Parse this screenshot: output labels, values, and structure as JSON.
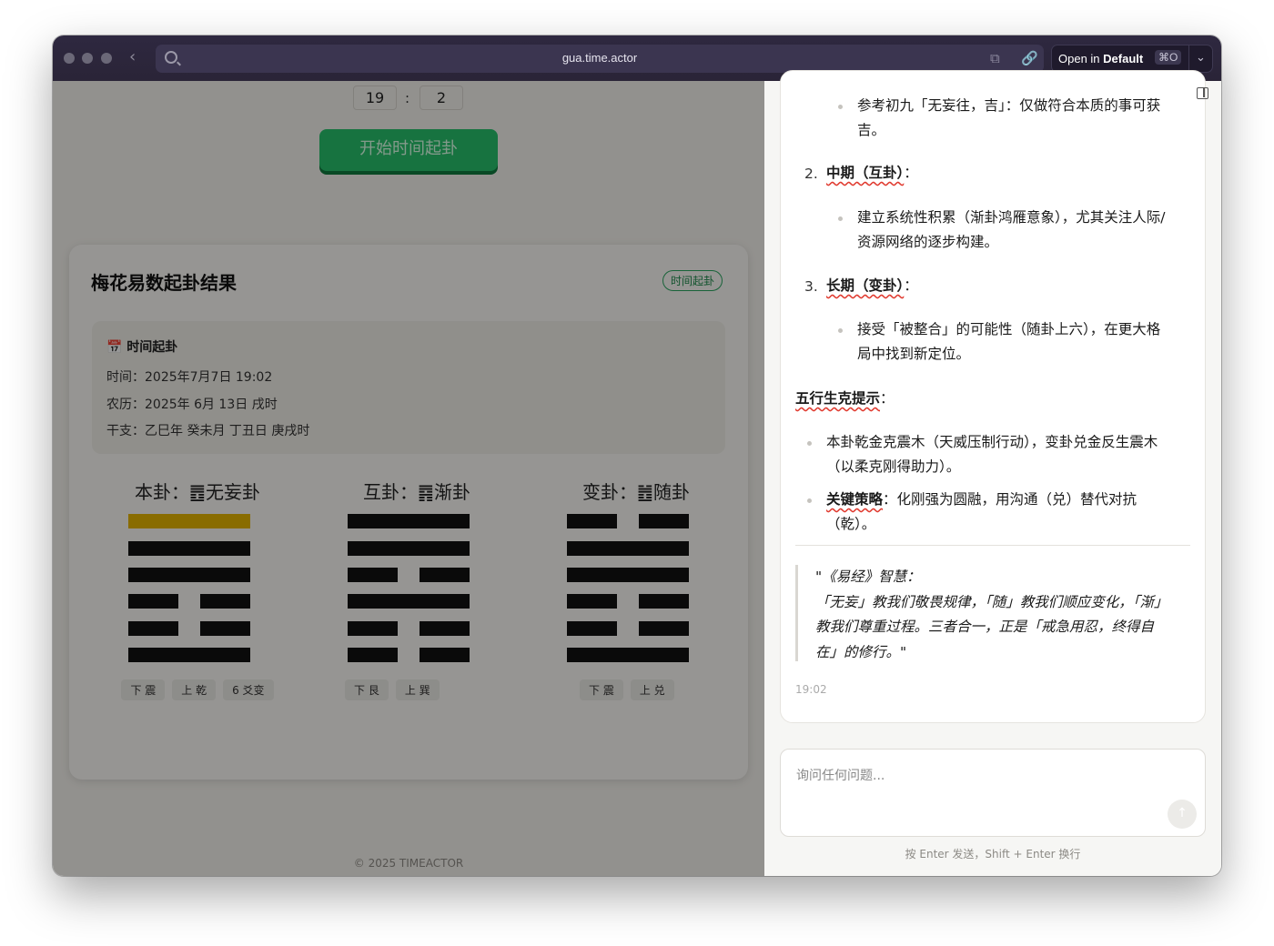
{
  "browser": {
    "url": "gua.time.actor",
    "open_label": "Open in",
    "open_target": "Default",
    "shortcut": "⌘O"
  },
  "left": {
    "time_inputs": [
      "19",
      "2"
    ],
    "colon": ":",
    "start_button": "开始时间起卦",
    "card": {
      "title": "梅花易数起卦结果",
      "tag": "时间起卦",
      "info_title": "📅 时间起卦",
      "info_lines": [
        "时间：2025年7月7日 19:02",
        "农历：2025年 6月 13日 戌时",
        "干支：乙巳年 癸未月 丁丑日 庚戌时"
      ],
      "hexagrams": [
        {
          "label": "本卦：䷘无妄卦",
          "chips": [
            "下 震",
            "上 乾",
            "6 爻变"
          ]
        },
        {
          "label": "互卦：䷴渐卦",
          "chips": [
            "下 艮",
            "上 巽"
          ]
        },
        {
          "label": "变卦：䷐随卦",
          "chips": [
            "下 震",
            "上 兑"
          ]
        }
      ]
    },
    "footer": "© 2025 TIMEACTOR"
  },
  "chat": {
    "lines": [
      "参考初九「无妄往，吉」：仅做符合本质的事可获",
      "吉。",
      "2.",
      "中期（互卦）",
      "：",
      "建立系统性积累（渐卦鸿雁意象），尤其关注人际/",
      "资源网络的逐步构建。",
      "3.",
      "长期（变卦）",
      "：",
      "接受「被整合」的可能性（随卦上六），在更大格",
      "局中找到新定位。",
      "五行生克提示",
      "：",
      "本卦乾金克震木（天威压制行动），变卦兑金反生震木",
      "（以柔克刚得助力）。",
      "关键策略",
      "：化刚强为圆融，用沟通（兑）替代对抗",
      "（乾）。"
    ],
    "quote": [
      "\"《易经》智慧：",
      "「无妄」教我们敬畏规律，「随」教我们顺应变化，「渐」",
      "教我们尊重过程。三者合一，正是「戒急用忍，终得自",
      "在」的修行。\""
    ],
    "timestamp": "19:02",
    "input_placeholder": "询问任何问题...",
    "hint": "按 Enter 发送，Shift + Enter 换行"
  }
}
